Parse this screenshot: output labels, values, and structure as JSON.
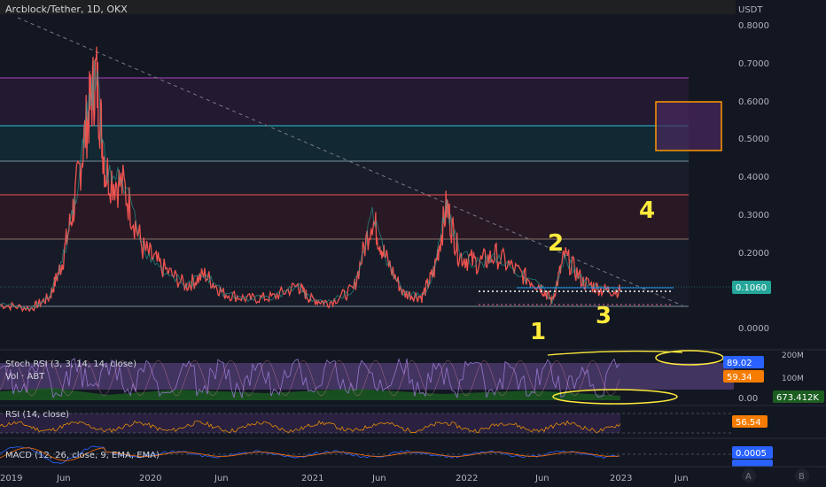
{
  "symbol_title": "Arcblock/Tether, 1D, OKX",
  "currency": "USDT",
  "colors": {
    "background": "#131722",
    "up": "#26a69a",
    "down": "#ef5350",
    "label_yellow": "#ffeb3b",
    "price_tag": "#26a69a",
    "stoch_tag": "#2962ff",
    "rsi_tag": "#f57c00",
    "stoch_line": "#7e57c2"
  },
  "chart_data": [
    {
      "type": "line",
      "title": "Arcblock/Tether, 1D, OKX",
      "ylabel": "USDT",
      "y_scale": "log",
      "ylim": [
        0.0,
        0.8
      ],
      "y_ticks": [
        "0.8000",
        "0.7000",
        "0.6000",
        "0.5000",
        "0.4000",
        "0.3000",
        "0.2000",
        "0.1000",
        "0.0000"
      ],
      "x_ticks": [
        "2019",
        "Jun",
        "2020",
        "Jun",
        "2021",
        "Jun",
        "2022",
        "Jun",
        "2023",
        "Jun"
      ],
      "current_price": "0.1060",
      "fib_levels": [
        0.66,
        0.53,
        0.44,
        0.35,
        0.24
      ],
      "annotations": [
        "1",
        "2",
        "3",
        "4"
      ],
      "price_path": [
        {
          "t": 0,
          "v": 0.07
        },
        {
          "t": 0.05,
          "v": 0.06
        },
        {
          "t": 0.08,
          "v": 0.09
        },
        {
          "t": 0.1,
          "v": 0.18
        },
        {
          "t": 0.12,
          "v": 0.34
        },
        {
          "t": 0.14,
          "v": 0.55
        },
        {
          "t": 0.155,
          "v": 0.68
        },
        {
          "t": 0.17,
          "v": 0.42
        },
        {
          "t": 0.2,
          "v": 0.38
        },
        {
          "t": 0.23,
          "v": 0.22
        },
        {
          "t": 0.26,
          "v": 0.17
        },
        {
          "t": 0.3,
          "v": 0.12
        },
        {
          "t": 0.33,
          "v": 0.15
        },
        {
          "t": 0.36,
          "v": 0.1
        },
        {
          "t": 0.4,
          "v": 0.085
        },
        {
          "t": 0.44,
          "v": 0.09
        },
        {
          "t": 0.48,
          "v": 0.12
        },
        {
          "t": 0.5,
          "v": 0.085
        },
        {
          "t": 0.53,
          "v": 0.075
        },
        {
          "t": 0.57,
          "v": 0.11
        },
        {
          "t": 0.6,
          "v": 0.3
        },
        {
          "t": 0.62,
          "v": 0.2
        },
        {
          "t": 0.65,
          "v": 0.1
        },
        {
          "t": 0.68,
          "v": 0.09
        },
        {
          "t": 0.7,
          "v": 0.16
        },
        {
          "t": 0.72,
          "v": 0.33
        },
        {
          "t": 0.74,
          "v": 0.2
        },
        {
          "t": 0.77,
          "v": 0.18
        },
        {
          "t": 0.8,
          "v": 0.2
        },
        {
          "t": 0.84,
          "v": 0.15
        },
        {
          "t": 0.87,
          "v": 0.12
        },
        {
          "t": 0.89,
          "v": 0.08
        },
        {
          "t": 0.91,
          "v": 0.2
        },
        {
          "t": 0.94,
          "v": 0.13
        },
        {
          "t": 0.97,
          "v": 0.11
        },
        {
          "t": 1.0,
          "v": 0.106
        }
      ]
    },
    {
      "type": "line",
      "title": "Stoch RSI (3, 3, 14, 14, close)",
      "legend_extra": "Vol · ABT",
      "values_shown": [
        "89.02",
        "59.34"
      ],
      "volume_ticks": [
        "200M",
        "100M"
      ],
      "volume_value": "673.412K",
      "y_ticks": [
        "0.00"
      ],
      "band": [
        20,
        80
      ]
    },
    {
      "type": "line",
      "title": "RSI (14, close)",
      "value_shown": "56.54",
      "band": [
        30,
        70
      ]
    },
    {
      "type": "line",
      "title": "MACD (12, 26, close, 9, EMA, EMA)",
      "value_shown": "0.0005"
    }
  ],
  "bottom_buttons": [
    "A",
    "B"
  ]
}
